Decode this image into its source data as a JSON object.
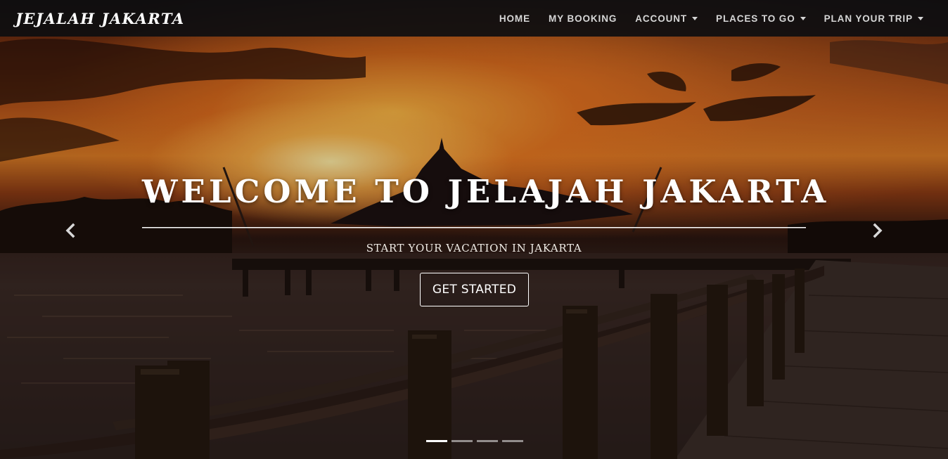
{
  "navbar": {
    "brand": "JEJALAH JAKARTA",
    "items": [
      {
        "label": "HOME",
        "dropdown": false
      },
      {
        "label": "MY BOOKING",
        "dropdown": false
      },
      {
        "label": "ACCOUNT",
        "dropdown": true
      },
      {
        "label": "PLACES TO GO",
        "dropdown": true
      },
      {
        "label": "PLAN YOUR TRIP",
        "dropdown": true
      }
    ]
  },
  "hero": {
    "title": "WELCOME TO JELAJAH JAKARTA",
    "subtitle": "START YOUR VACATION IN JAKARTA",
    "cta_label": "GET STARTED",
    "prev_icon": "chevron-left-icon",
    "next_icon": "chevron-right-icon",
    "slide_count": 4,
    "active_slide": 1
  },
  "colors": {
    "navbar_bg": "#0e0e10",
    "text": "#ffffff",
    "nav_text": "#d6d6d6"
  }
}
